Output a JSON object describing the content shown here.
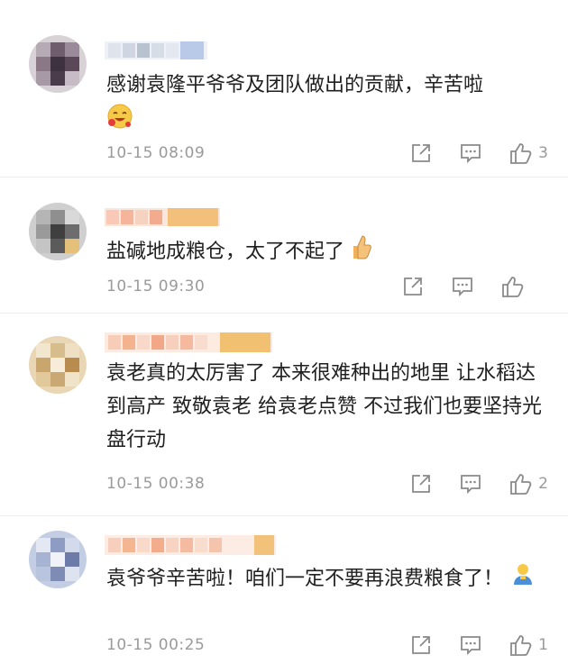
{
  "comments": [
    {
      "text": "感谢袁隆平爷爷及团队做出的贡献，辛苦啦",
      "emoji": "laughing-face-emoji",
      "time": "10-15 08:09",
      "likes": "3",
      "avatar_colors": [
        "#d8d1d6",
        "#6f5c6c",
        "#3e3240",
        "#9b8a9a"
      ],
      "name_colors": [
        "#cfd8e6",
        "#b8c4d9",
        "#e6edf7",
        "#9fb4d9"
      ]
    },
    {
      "text": "盐碱地成粮仓，太了不起了",
      "emoji": "thumbs-up-emoji",
      "time": "10-15 09:30",
      "likes": "",
      "avatar_colors": [
        "#cfcfcf",
        "#5b5b5b",
        "#8f8f8f",
        "#e4c07a"
      ],
      "name_colors": [
        "#f6c9b6",
        "#f3b28a",
        "#f0c37a",
        "#f5d8a8"
      ]
    },
    {
      "text": "袁老真的太厉害了 本来很难种出的地里 让水稻达到高产 致敬袁老 给袁老点赞 不过我们也要坚持光盘行动",
      "emoji": "",
      "time": "10-15 00:38",
      "likes": "2",
      "avatar_colors": [
        "#e8d6b5",
        "#c9a66e",
        "#f2e6cf",
        "#b88b4f"
      ],
      "name_colors": [
        "#f7cdb8",
        "#f3b38f",
        "#f1c070",
        "#f6dcc4"
      ]
    },
    {
      "text": "袁爷爷辛苦啦！咱们一定不要再浪费粮食了！",
      "emoji": "person-emoji",
      "time": "10-15 00:25",
      "likes": "1",
      "avatar_colors": [
        "#c3cde4",
        "#8e9cc4",
        "#e3e8f3",
        "#6d7ba8"
      ],
      "name_colors": [
        "#f8cfbd",
        "#f4b690",
        "#f2c27b",
        "#f7dcc7"
      ]
    }
  ]
}
